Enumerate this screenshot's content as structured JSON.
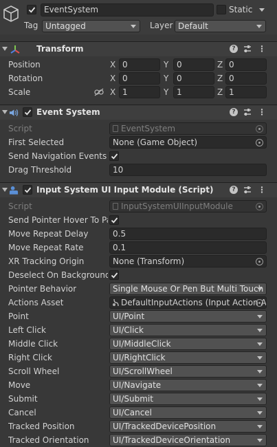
{
  "gameobject": {
    "name": "EventSystem",
    "static_label": "Static",
    "tag_label": "Tag",
    "tag_value": "Untagged",
    "layer_label": "Layer",
    "layer_value": "Default"
  },
  "transform": {
    "title": "Transform",
    "rows": [
      {
        "label": "Position",
        "x": "0",
        "y": "0",
        "z": "0"
      },
      {
        "label": "Rotation",
        "x": "0",
        "y": "0",
        "z": "0"
      },
      {
        "label": "Scale",
        "x": "1",
        "y": "1",
        "z": "1"
      }
    ],
    "axis": {
      "x": "X",
      "y": "Y",
      "z": "Z"
    }
  },
  "event_system": {
    "title": "Event System",
    "script_label": "Script",
    "script_value": "EventSystem",
    "first_selected_label": "First Selected",
    "first_selected_value": "None (Game Object)",
    "send_nav_label": "Send Navigation Events",
    "drag_threshold_label": "Drag Threshold",
    "drag_threshold_value": "10"
  },
  "input_module": {
    "title": "Input System UI Input Module (Script)",
    "script_label": "Script",
    "script_value": "InputSystemUIInputModule",
    "send_hover_label": "Send Pointer Hover To Pa",
    "move_delay_label": "Move Repeat Delay",
    "move_delay_value": "0.5",
    "move_rate_label": "Move Repeat Rate",
    "move_rate_value": "0.1",
    "xr_label": "XR Tracking Origin",
    "xr_value": "None (Transform)",
    "deselect_label": "Deselect On Background C",
    "pointer_behavior_label": "Pointer Behavior",
    "pointer_behavior_value": "Single Mouse Or Pen But Multi Touch",
    "actions_asset_label": "Actions Asset",
    "actions_asset_value": "DefaultInputActions (Input Action A",
    "actions": [
      {
        "label": "Point",
        "value": "UI/Point"
      },
      {
        "label": "Left Click",
        "value": "UI/Click"
      },
      {
        "label": "Middle Click",
        "value": "UI/MiddleClick"
      },
      {
        "label": "Right Click",
        "value": "UI/RightClick"
      },
      {
        "label": "Scroll Wheel",
        "value": "UI/ScrollWheel"
      },
      {
        "label": "Move",
        "value": "UI/Navigate"
      },
      {
        "label": "Submit",
        "value": "UI/Submit"
      },
      {
        "label": "Cancel",
        "value": "UI/Cancel"
      },
      {
        "label": "Tracked Position",
        "value": "UI/TrackedDevicePosition"
      },
      {
        "label": "Tracked Orientation",
        "value": "UI/TrackedDeviceOrientation"
      }
    ]
  }
}
